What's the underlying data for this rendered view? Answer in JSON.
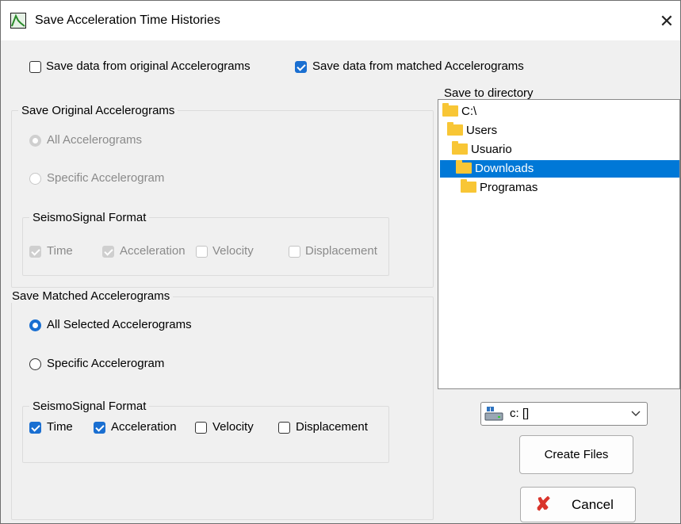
{
  "window": {
    "title": "Save Acceleration Time Histories"
  },
  "top_options": {
    "save_original": {
      "label": "Save data from original Accelerograms",
      "checked": false
    },
    "save_matched": {
      "label": "Save data from matched Accelerograms",
      "checked": true
    }
  },
  "original_group": {
    "title": "Save Original Accelerograms",
    "radio_all": "All Accelerograms",
    "radio_specific": "Specific Accelerogram",
    "format_title": "SeismoSignal Format",
    "format_items": [
      "Time",
      "Acceleration",
      "Velocity",
      "Displacement"
    ]
  },
  "matched_group": {
    "title": "Save Matched Accelerograms",
    "radio_all": "All Selected Accelerograms",
    "radio_specific": "Specific Accelerogram",
    "format_title": "SeismoSignal Format",
    "format_items": [
      "Time",
      "Acceleration",
      "Velocity",
      "Displacement"
    ]
  },
  "directory": {
    "label": "Save to directory",
    "tree": [
      "C:\\",
      "Users",
      "Usuario",
      "Downloads",
      "Programas"
    ],
    "selected": "Downloads"
  },
  "drive_select": {
    "value": "c: []"
  },
  "buttons": {
    "create": "Create Files",
    "cancel": "Cancel"
  },
  "colors": {
    "accent": "#1a6fd1",
    "selection": "#0078d7",
    "folder": "#f8c635",
    "cancel_icon": "#d9342b"
  }
}
